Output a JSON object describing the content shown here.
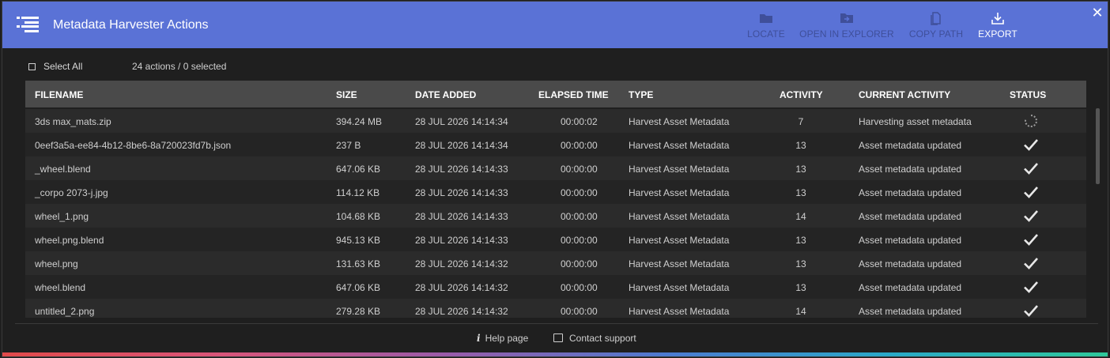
{
  "window": {
    "title": "Metadata Harvester Actions",
    "close_label": "✕"
  },
  "toolbar": {
    "locate": "LOCATE",
    "open_in_explorer": "OPEN IN EXPLORER",
    "copy_path": "COPY PATH",
    "export": "EXPORT"
  },
  "selection": {
    "select_all": "Select All",
    "count": "24 actions / 0 selected"
  },
  "table": {
    "columns": [
      "FILENAME",
      "SIZE",
      "DATE ADDED",
      "ELAPSED TIME",
      "TYPE",
      "ACTIVITY",
      "CURRENT ACTIVITY",
      "STATUS"
    ],
    "rows": [
      {
        "filename": "3ds max_mats.zip",
        "size": "394.24 MB",
        "date": "28 JUL 2026 14:14:34",
        "elapsed": "00:00:02",
        "type": "Harvest Asset Metadata",
        "activity": "7",
        "current": "Harvesting asset metadata",
        "status": "in-progress"
      },
      {
        "filename": "0eef3a5a-ee84-4b12-8be6-8a720023fd7b.json",
        "size": "237 B",
        "date": "28 JUL 2026 14:14:34",
        "elapsed": "00:00:00",
        "type": "Harvest Asset Metadata",
        "activity": "13",
        "current": "Asset metadata updated",
        "status": "done"
      },
      {
        "filename": "_wheel.blend",
        "size": "647.06 KB",
        "date": "28 JUL 2026 14:14:33",
        "elapsed": "00:00:00",
        "type": "Harvest Asset Metadata",
        "activity": "13",
        "current": "Asset metadata updated",
        "status": "done"
      },
      {
        "filename": "_corpo 2073-j.jpg",
        "size": "114.12 KB",
        "date": "28 JUL 2026 14:14:33",
        "elapsed": "00:00:00",
        "type": "Harvest Asset Metadata",
        "activity": "13",
        "current": "Asset metadata updated",
        "status": "done"
      },
      {
        "filename": "wheel_1.png",
        "size": "104.68 KB",
        "date": "28 JUL 2026 14:14:33",
        "elapsed": "00:00:00",
        "type": "Harvest Asset Metadata",
        "activity": "14",
        "current": "Asset metadata updated",
        "status": "done"
      },
      {
        "filename": "wheel.png.blend",
        "size": "945.13 KB",
        "date": "28 JUL 2026 14:14:33",
        "elapsed": "00:00:00",
        "type": "Harvest Asset Metadata",
        "activity": "13",
        "current": "Asset metadata updated",
        "status": "done"
      },
      {
        "filename": "wheel.png",
        "size": "131.63 KB",
        "date": "28 JUL 2026 14:14:32",
        "elapsed": "00:00:00",
        "type": "Harvest Asset Metadata",
        "activity": "13",
        "current": "Asset metadata updated",
        "status": "done"
      },
      {
        "filename": "wheel.blend",
        "size": "647.06 KB",
        "date": "28 JUL 2026 14:14:32",
        "elapsed": "00:00:00",
        "type": "Harvest Asset Metadata",
        "activity": "13",
        "current": "Asset metadata updated",
        "status": "done"
      },
      {
        "filename": "untitled_2.png",
        "size": "279.28 KB",
        "date": "28 JUL 2026 14:14:32",
        "elapsed": "00:00:00",
        "type": "Harvest Asset Metadata",
        "activity": "14",
        "current": "Asset metadata updated",
        "status": "done"
      }
    ]
  },
  "footer": {
    "help": "Help page",
    "support": "Contact support"
  },
  "colors": {
    "titlebar": "#5a72d6",
    "header": "#4a4a4a",
    "background": "#1f1f1f"
  },
  "icons": {
    "menu": "list-menu-icon",
    "locate": "folder-icon",
    "open_in_explorer": "folder-open-arrow-icon",
    "copy_path": "copy-file-icon",
    "export": "download-icon",
    "close": "close-icon",
    "status_done": "checkmark-icon",
    "status_in_progress": "spinner-icon",
    "help": "info-icon",
    "support": "chat-bubble-icon"
  }
}
